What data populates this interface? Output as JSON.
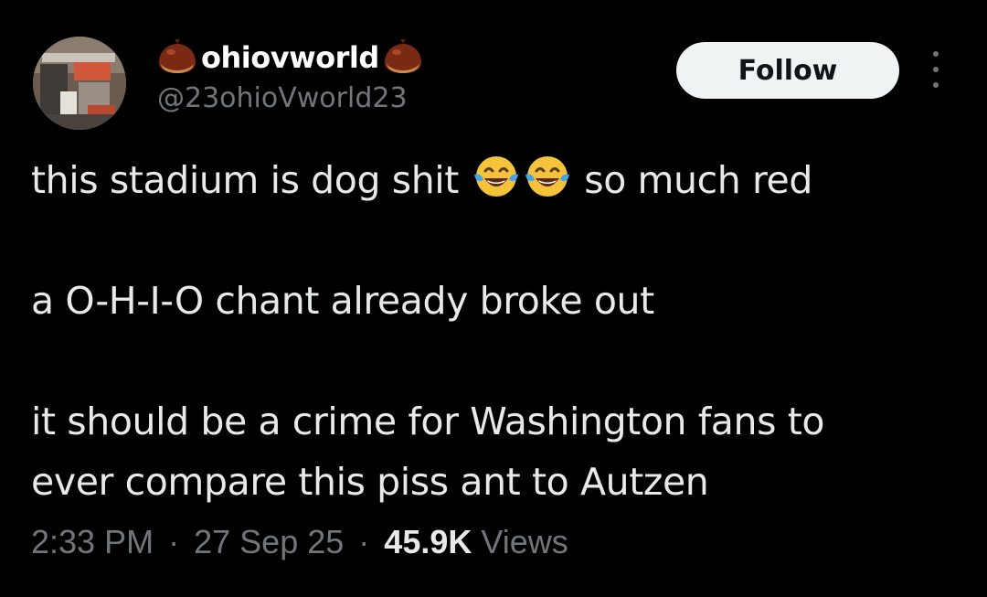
{
  "author": {
    "display_name": "ohiovworld",
    "handle": "@23ohioVworld23",
    "badge_icon": "chestnut-icon"
  },
  "actions": {
    "follow_label": "Follow",
    "more_icon": "more-options-icon"
  },
  "tweet": {
    "line1_before_emoji": "this stadium is dog shit",
    "line1_emoji": "face-with-tears-of-joy",
    "line1_after_emoji": "so much red",
    "line2": "a O-H-I-O chant already broke out",
    "line3": "it should be a crime for Washington fans to",
    "line4": "ever compare this piss ant to Autzen"
  },
  "meta": {
    "time": "2:33 PM",
    "date": "27 Sep 25",
    "views_count": "45.9K",
    "views_label": "Views",
    "separator": "·"
  },
  "colors": {
    "background": "#000000",
    "primary_text": "#e7e9ea",
    "secondary_text": "#71767b",
    "follow_bg": "#eff3f4",
    "follow_text": "#0f1419"
  }
}
